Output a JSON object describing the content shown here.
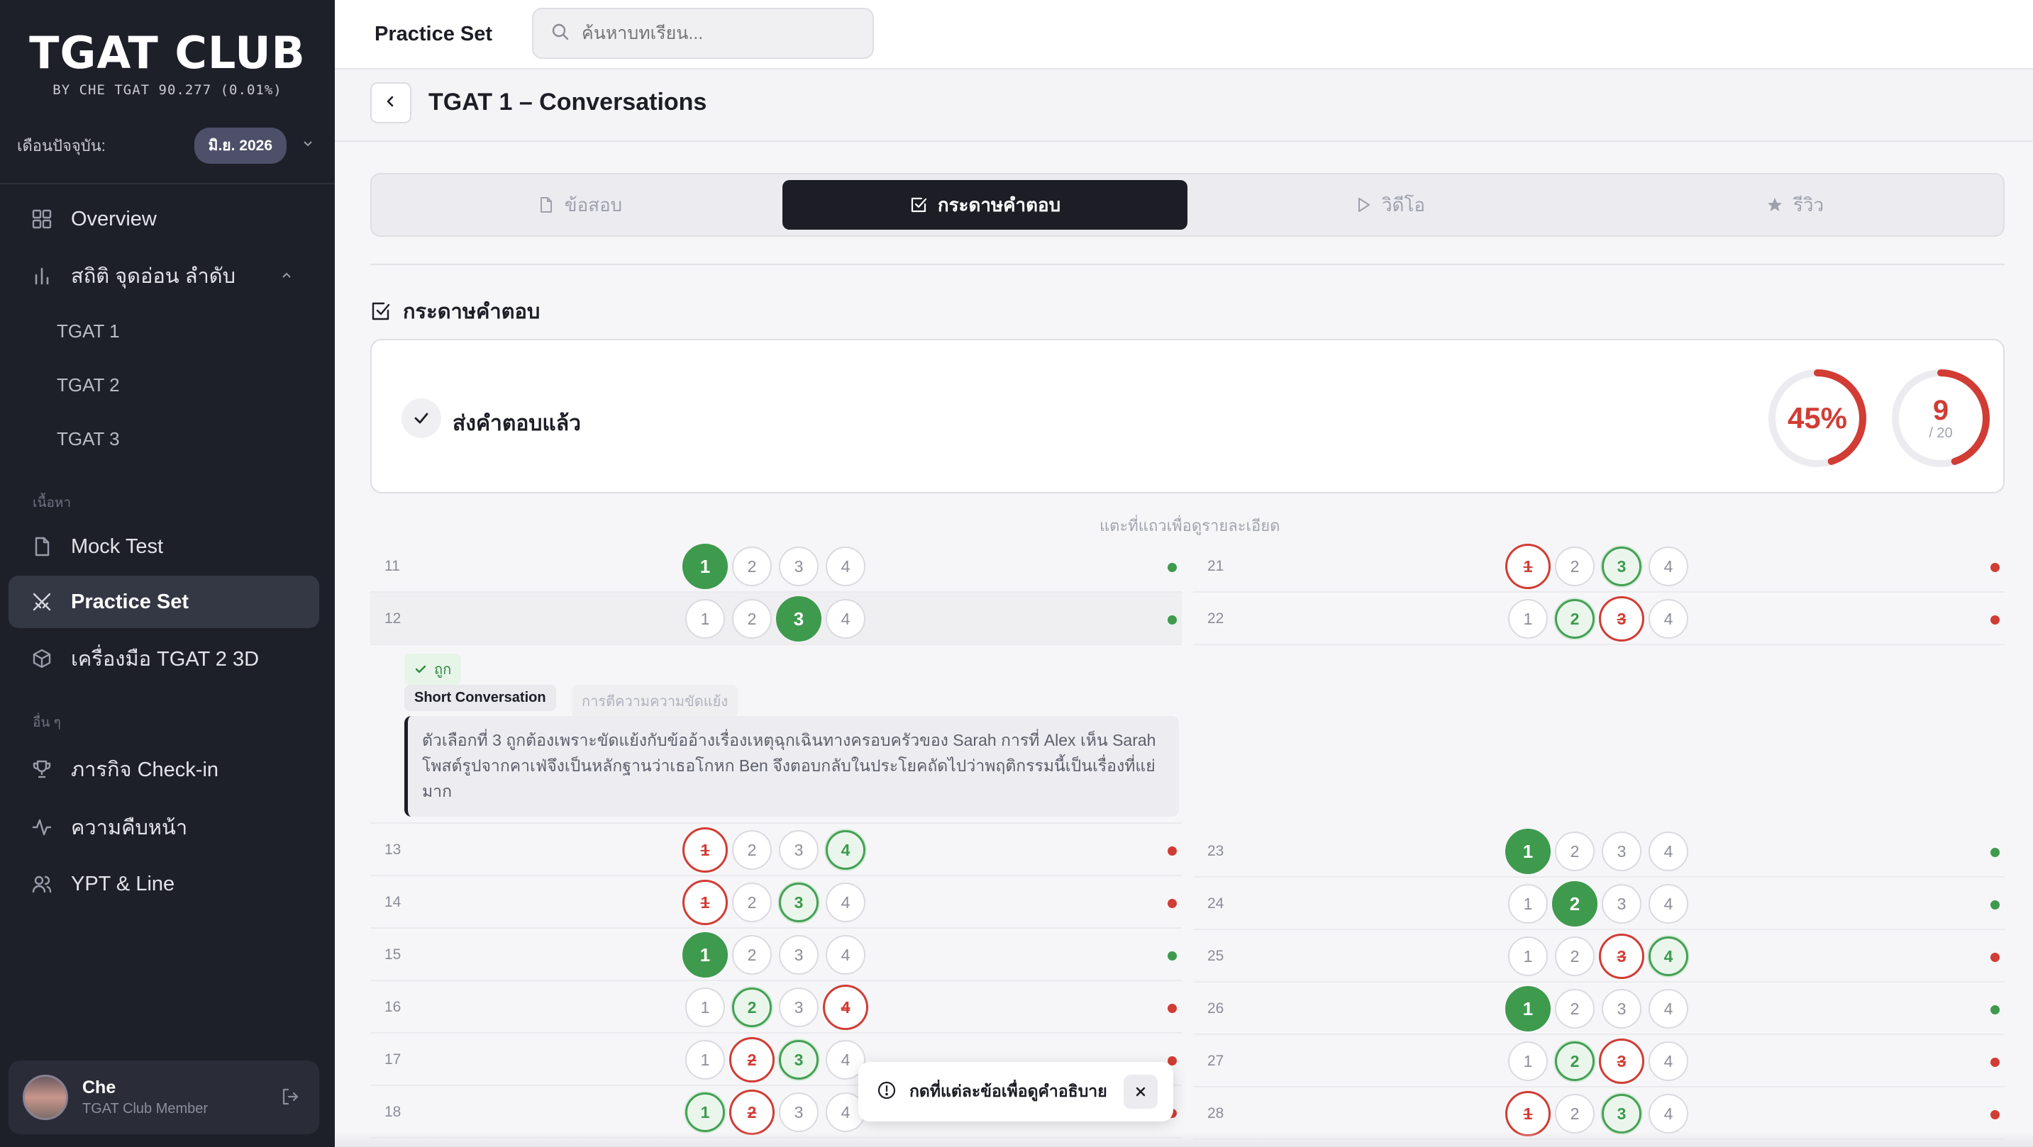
{
  "sidebar": {
    "logo": "TGAT CLUB",
    "logo_sub": "BY CHE TGAT 90.277 (0.01%)",
    "month_label": "เดือนปัจจุบัน:",
    "month_value": "มิ.ย. 2026",
    "overview": "Overview",
    "stats": "สถิติ จุดอ่อน ลำดับ",
    "stats_sub": [
      "TGAT 1",
      "TGAT 2",
      "TGAT 3"
    ],
    "section_content": "เนื้อหา",
    "mock_test": "Mock Test",
    "practice_set": "Practice Set",
    "tgat2_tool": "เครื่องมือ TGAT 2 3D",
    "section_other": "อื่น ๆ",
    "checkin": "ภารกิจ Check-in",
    "progress": "ความคืบหน้า",
    "ypt": "YPT & Line",
    "user_name": "Che",
    "user_role": "TGAT Club Member"
  },
  "topbar": {
    "title": "Practice Set",
    "search_placeholder": "ค้นหาบทเรียน..."
  },
  "page": {
    "title": "TGAT 1 – Conversations"
  },
  "tabs": [
    {
      "label": "ข้อสอบ",
      "icon": "file-icon"
    },
    {
      "label": "กระดาษคำตอบ",
      "icon": "check-square-icon"
    },
    {
      "label": "วิดีโอ",
      "icon": "play-icon"
    },
    {
      "label": "รีวิว",
      "icon": "star-icon"
    }
  ],
  "sheet": {
    "section_title": "กระดาษคำตอบ",
    "submitted_label": "ส่งคำตอบแล้ว",
    "score_percent": "45%",
    "score_percent_value": 0.45,
    "score": "9",
    "score_total": "/ 20",
    "hint": "แตะที่แถวเพื่อดูรายละเอียด",
    "explain": {
      "status": "ถูก",
      "type": "Short Conversation",
      "skill": "การตีความความขัดแย้ง",
      "text": "ตัวเลือกที่ 3 ถูกต้องเพราะขัดแย้งกับข้ออ้างเรื่องเหตุฉุกเฉินทางครอบครัวของ Sarah การที่ Alex เห็น Sarah โพสต์รูปจากคาเฟ่จึงเป็นหลักฐานว่าเธอโกหก Ben จึงตอบกลับในประโยคถัดไปว่าพฤติกรรมนี้เป็นเรื่องที่แย่มาก"
    },
    "left_rows": [
      {
        "num": "11",
        "sel": 1,
        "correct": 1,
        "result": "ok"
      },
      {
        "num": "12",
        "sel": 3,
        "correct": 3,
        "result": "ok"
      },
      {
        "num": "13",
        "sel": 1,
        "correct": 4,
        "result": "bad"
      },
      {
        "num": "14",
        "sel": 1,
        "correct": 3,
        "result": "bad"
      },
      {
        "num": "15",
        "sel": 1,
        "correct": 1,
        "result": "ok"
      },
      {
        "num": "16",
        "sel": 4,
        "correct": 2,
        "result": "bad"
      },
      {
        "num": "17",
        "sel": 2,
        "correct": 3,
        "result": "bad"
      },
      {
        "num": "18",
        "sel": 2,
        "correct": 1,
        "result": "bad"
      }
    ],
    "right_rows": [
      {
        "num": "21",
        "sel": 1,
        "correct": 3,
        "result": "bad"
      },
      {
        "num": "22",
        "sel": 3,
        "correct": 2,
        "result": "bad"
      },
      {
        "num": "23",
        "sel": 1,
        "correct": 1,
        "result": "ok"
      },
      {
        "num": "24",
        "sel": 2,
        "correct": 2,
        "result": "ok"
      },
      {
        "num": "25",
        "sel": 3,
        "correct": 4,
        "result": "bad"
      },
      {
        "num": "26",
        "sel": 1,
        "correct": 1,
        "result": "ok"
      },
      {
        "num": "27",
        "sel": 3,
        "correct": 2,
        "result": "bad"
      },
      {
        "num": "28",
        "sel": 1,
        "correct": 3,
        "result": "bad"
      }
    ]
  },
  "toast": {
    "text": "กดที่แต่ละข้อเพื่อดูคำอธิบาย"
  },
  "colors": {
    "sidebar_bg": "#1e2029",
    "accent_dark": "#1c1d25",
    "correct_green": "#3e9a4d",
    "wrong_red": "#d13c34"
  }
}
